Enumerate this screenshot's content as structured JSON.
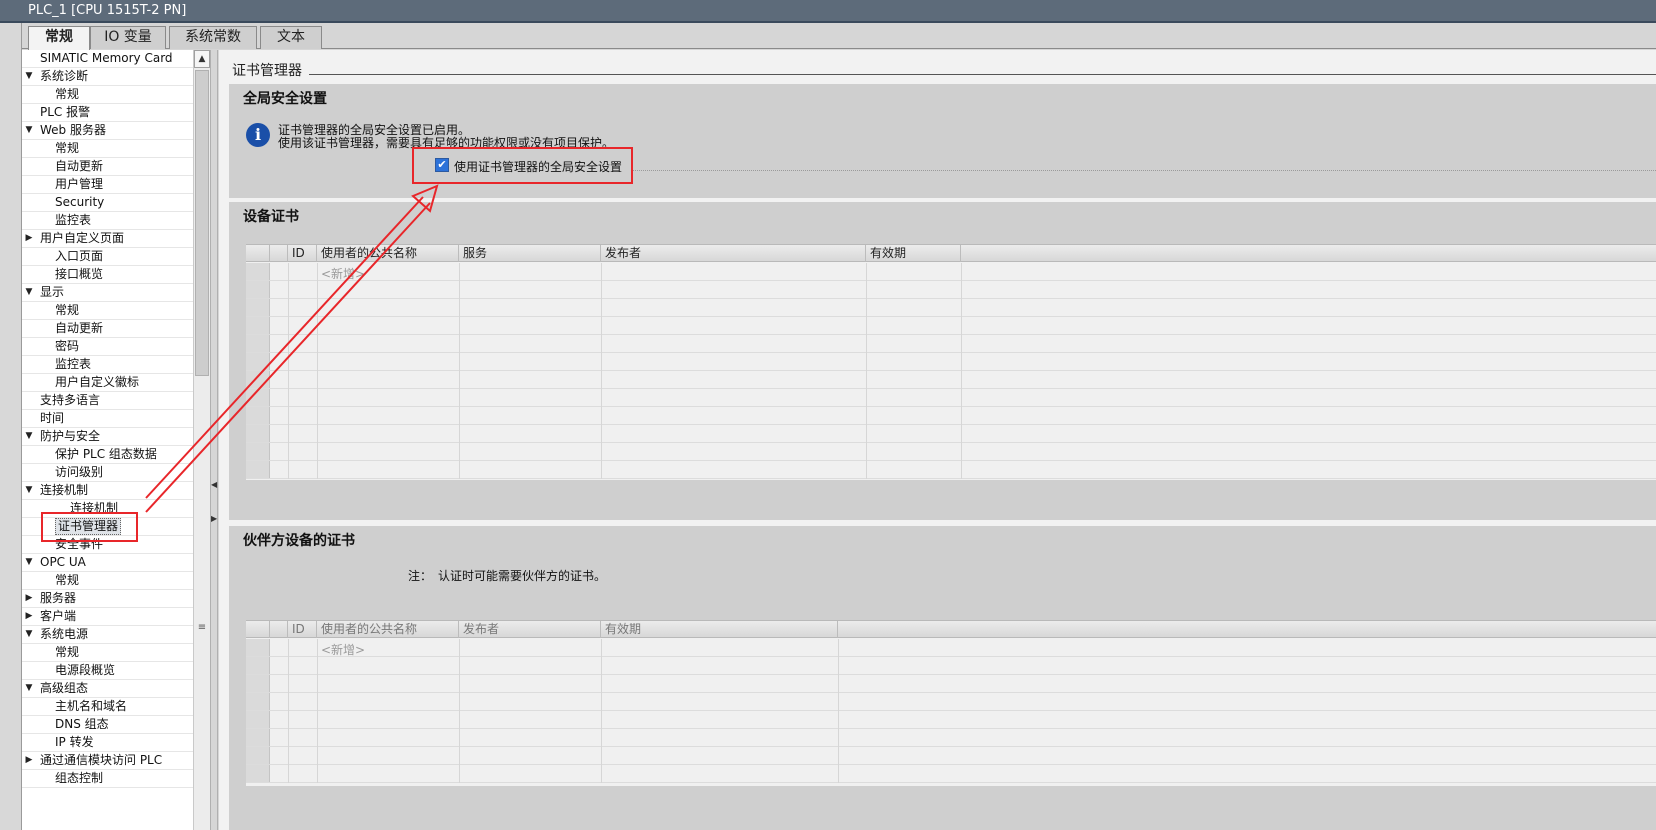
{
  "window": {
    "title": "PLC_1 [CPU 1515T-2 PN]"
  },
  "tabs": [
    {
      "label": "常规",
      "active": true
    },
    {
      "label": "IO 变量",
      "active": false
    },
    {
      "label": "系统常数",
      "active": false
    },
    {
      "label": "文本",
      "active": false
    }
  ],
  "nav": {
    "items": [
      {
        "label": "SIMATIC Memory Card",
        "level": 1,
        "expander": "none"
      },
      {
        "label": "系统诊断",
        "level": 0,
        "expander": "expanded"
      },
      {
        "label": "常规",
        "level": 2,
        "expander": "none"
      },
      {
        "label": "PLC 报警",
        "level": 1,
        "expander": "none"
      },
      {
        "label": "Web 服务器",
        "level": 0,
        "expander": "expanded"
      },
      {
        "label": "常规",
        "level": 2,
        "expander": "none"
      },
      {
        "label": "自动更新",
        "level": 2,
        "expander": "none"
      },
      {
        "label": "用户管理",
        "level": 2,
        "expander": "none"
      },
      {
        "label": "Security",
        "level": 2,
        "expander": "none"
      },
      {
        "label": "监控表",
        "level": 2,
        "expander": "none"
      },
      {
        "label": "用户自定义页面",
        "level": 1,
        "expander": "collapsed"
      },
      {
        "label": "入口页面",
        "level": 2,
        "expander": "none"
      },
      {
        "label": "接口概览",
        "level": 2,
        "expander": "none"
      },
      {
        "label": "显示",
        "level": 0,
        "expander": "expanded"
      },
      {
        "label": "常规",
        "level": 2,
        "expander": "none"
      },
      {
        "label": "自动更新",
        "level": 2,
        "expander": "none"
      },
      {
        "label": "密码",
        "level": 2,
        "expander": "none"
      },
      {
        "label": "监控表",
        "level": 2,
        "expander": "none"
      },
      {
        "label": "用户自定义徽标",
        "level": 2,
        "expander": "none"
      },
      {
        "label": "支持多语言",
        "level": 1,
        "expander": "none"
      },
      {
        "label": "时间",
        "level": 1,
        "expander": "none"
      },
      {
        "label": "防护与安全",
        "level": 0,
        "expander": "expanded"
      },
      {
        "label": "保护 PLC 组态数据",
        "level": 2,
        "expander": "none"
      },
      {
        "label": "访问级别",
        "level": 2,
        "expander": "none"
      },
      {
        "label": "连接机制",
        "level": 1,
        "expander": "expanded"
      },
      {
        "label": "连接机制",
        "level": 3,
        "expander": "none"
      },
      {
        "label": "证书管理器",
        "level": 2,
        "expander": "none",
        "selected": true
      },
      {
        "label": "安全事件",
        "level": 2,
        "expander": "none"
      },
      {
        "label": "OPC UA",
        "level": 0,
        "expander": "expanded"
      },
      {
        "label": "常规",
        "level": 2,
        "expander": "none"
      },
      {
        "label": "服务器",
        "level": 1,
        "expander": "collapsed"
      },
      {
        "label": "客户端",
        "level": 1,
        "expander": "collapsed"
      },
      {
        "label": "系统电源",
        "level": 0,
        "expander": "expanded"
      },
      {
        "label": "常规",
        "level": 2,
        "expander": "none"
      },
      {
        "label": "电源段概览",
        "level": 2,
        "expander": "none"
      },
      {
        "label": "高级组态",
        "level": 0,
        "expander": "expanded"
      },
      {
        "label": "主机名和域名",
        "level": 2,
        "expander": "none"
      },
      {
        "label": "DNS 组态",
        "level": 2,
        "expander": "none"
      },
      {
        "label": "IP 转发",
        "level": 2,
        "expander": "none"
      },
      {
        "label": "通过通信模块访问 PLC",
        "level": 1,
        "expander": "collapsed"
      },
      {
        "label": "组态控制",
        "level": 2,
        "expander": "none"
      }
    ]
  },
  "content": {
    "page_title": "证书管理器",
    "global_security": {
      "title": "全局安全设置",
      "info_line1": "证书管理器的全局安全设置已启用。",
      "info_line2": "使用该证书管理器，需要具有足够的功能权限或没有项目保护。",
      "checkbox_label": "使用证书管理器的全局安全设置",
      "checkbox_checked": true
    },
    "device_certificates": {
      "title": "设备证书",
      "columns": [
        "ID",
        "使用者的公共名称",
        "服务",
        "发布者",
        "有效期"
      ],
      "add_placeholder": "<新增>",
      "row_count": 12
    },
    "partner_certificates": {
      "title": "伙伴方设备的证书",
      "note_label": "注：",
      "note_text": "认证时可能需要伙伴方的证书。",
      "columns": [
        "ID",
        "使用者的公共名称",
        "发布者",
        "有效期"
      ],
      "add_placeholder": "<新增>",
      "row_count": 8
    }
  },
  "icons": {
    "info": "info-icon",
    "expanded": "triangle-down-icon",
    "collapsed": "triangle-right-icon",
    "scroll_up": "chevron-up-icon",
    "grip": "grip-icon"
  },
  "colors": {
    "titlebar": "#5d6b7a",
    "annotation": "#e8262a",
    "checkbox": "#2d72d9",
    "info_icon": "#1a4fa8"
  }
}
